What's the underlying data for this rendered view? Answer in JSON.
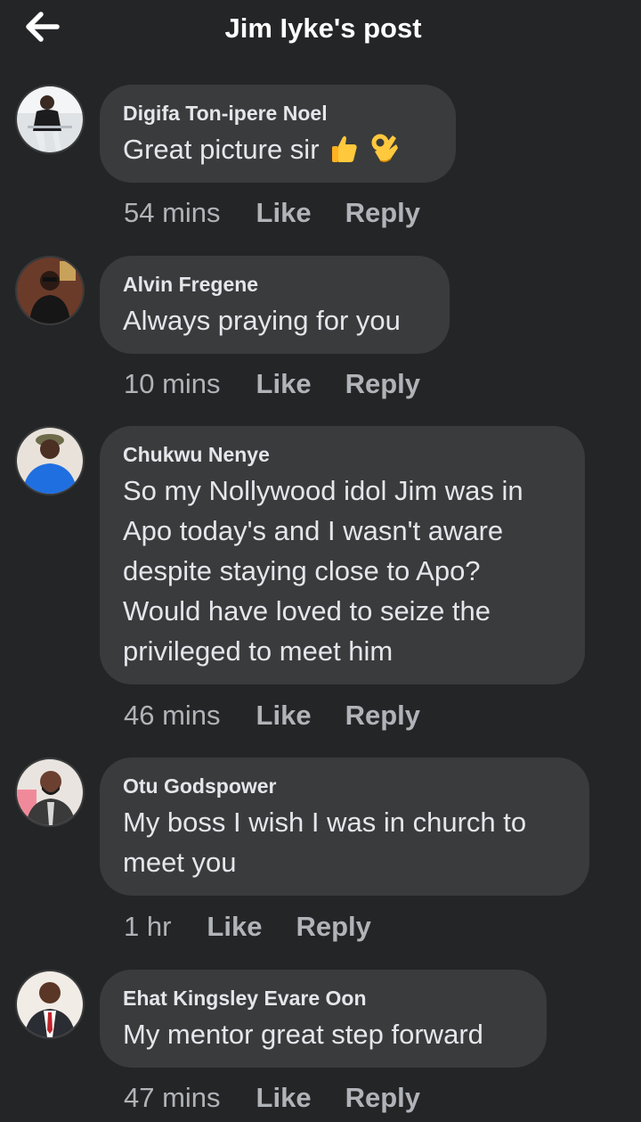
{
  "header": {
    "title": "Jim Iyke's post"
  },
  "comments": [
    {
      "author": "Digifa Ton-ipere Noel",
      "text": "Great picture sir",
      "emojis": [
        "thumbs-up-emoji",
        "ok-hand-emoji"
      ],
      "time": "54 mins",
      "like_label": "Like",
      "reply_label": "Reply"
    },
    {
      "author": "Alvin Fregene",
      "text": "Always praying for you",
      "time": "10 mins",
      "like_label": "Like",
      "reply_label": "Reply"
    },
    {
      "author": "Chukwu Nenye",
      "text": "So my Nollywood idol Jim was in\nApo today's and I wasn't aware\ndespite staying close to Apo?\nWould have loved to seize the\nprivileged to meet him",
      "time": "46 mins",
      "like_label": "Like",
      "reply_label": "Reply"
    },
    {
      "author": "Otu Godspower",
      "text": "My boss I wish I was in church to\nmeet you",
      "time": "1 hr",
      "like_label": "Like",
      "reply_label": "Reply"
    },
    {
      "author": "Ehat Kingsley Evare Oon",
      "text": "My mentor great step forward",
      "time": "47 mins",
      "like_label": "Like",
      "reply_label": "Reply"
    }
  ],
  "colors": {
    "background": "#242526",
    "bubble": "#3a3b3c",
    "primary_text": "#e4e6eb",
    "secondary_text": "#b0b3b8"
  }
}
